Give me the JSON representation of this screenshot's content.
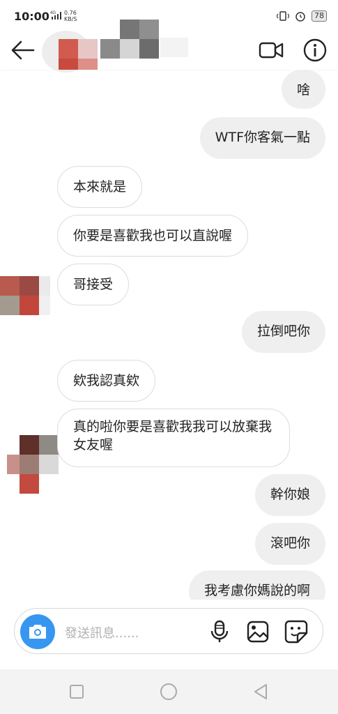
{
  "status_bar": {
    "time": "10:00",
    "network": "4G",
    "speed_value": "0.76",
    "speed_unit": "KB/S",
    "battery": "78"
  },
  "header": {
    "back_icon": "arrow-left-icon",
    "video_icon": "video-camera-icon",
    "info_icon": "info-icon"
  },
  "messages": [
    {
      "side": "out",
      "text": "啥"
    },
    {
      "side": "out",
      "text": "WTF你客氣一點"
    },
    {
      "side": "in",
      "text": "本來就是"
    },
    {
      "side": "in",
      "text": "你要是喜歡我也可以直說喔"
    },
    {
      "side": "in",
      "text": "哥接受"
    },
    {
      "side": "out",
      "text": "拉倒吧你"
    },
    {
      "side": "in",
      "text": "欸我認真欸"
    },
    {
      "side": "in",
      "text": "真的啦你要是喜歡我我可以放棄我女友喔"
    },
    {
      "side": "out",
      "text": "幹你娘"
    },
    {
      "side": "out",
      "text": "滾吧你"
    },
    {
      "side": "out",
      "text": "我考慮你媽說的啊"
    }
  ],
  "composer": {
    "placeholder": "發送訊息......",
    "camera_icon": "camera-icon",
    "mic_icon": "microphone-icon",
    "image_icon": "image-icon",
    "sticker_icon": "sticker-icon"
  },
  "colors": {
    "accent": "#3797f0",
    "outgoing_bubble": "#efefef",
    "incoming_border": "#dcdcdc"
  }
}
